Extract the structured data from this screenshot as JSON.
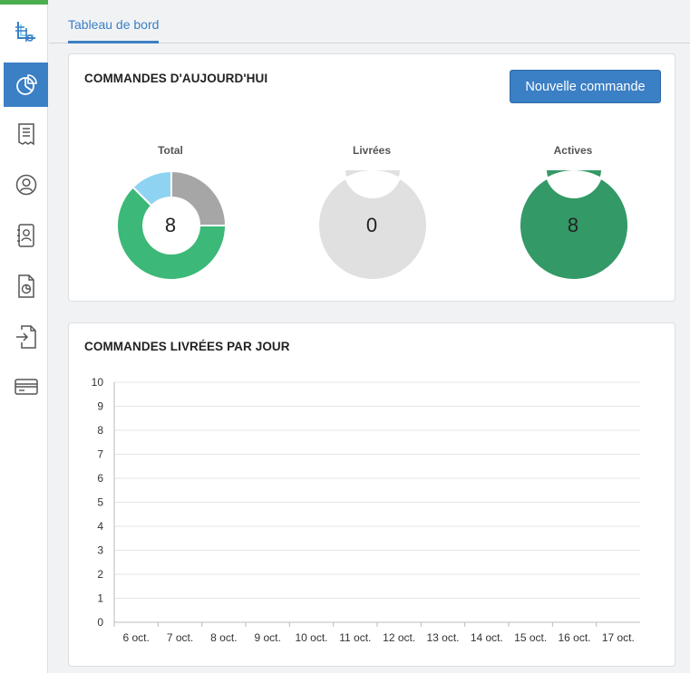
{
  "sidebar": {
    "items": [
      {
        "name": "logo",
        "icon": "app-logo-icon"
      },
      {
        "name": "dashboard",
        "icon": "pie-chart-icon",
        "active": true
      },
      {
        "name": "orders",
        "icon": "receipt-icon"
      },
      {
        "name": "users",
        "icon": "user-circle-icon"
      },
      {
        "name": "contacts",
        "icon": "contact-book-icon"
      },
      {
        "name": "reports",
        "icon": "document-chart-icon"
      },
      {
        "name": "import",
        "icon": "file-import-icon"
      },
      {
        "name": "billing",
        "icon": "credit-card-icon"
      }
    ],
    "accent": "#3b7fc4",
    "top_bar_color": "#4cae4c"
  },
  "tabs": [
    {
      "label": "Tableau de bord",
      "active": true
    }
  ],
  "today_card": {
    "title": "COMMANDES D'AUJOURD'HUI",
    "new_order_button": "Nouvelle commande",
    "donuts": [
      {
        "label": "Total",
        "value": "8",
        "segments": [
          {
            "fraction": 0.25,
            "color": "#a6a6a6"
          },
          {
            "fraction": 0.625,
            "color": "#3cb878"
          },
          {
            "fraction": 0.125,
            "color": "#8fd3f2"
          }
        ]
      },
      {
        "label": "Livrées",
        "value": "0",
        "segments": [
          {
            "fraction": 1.0,
            "color": "#e0e0e0"
          }
        ]
      },
      {
        "label": "Actives",
        "value": "8",
        "segments": [
          {
            "fraction": 1.0,
            "color": "#339966"
          }
        ]
      }
    ]
  },
  "delivered_card": {
    "title": "COMMANDES LIVRÉES PAR JOUR"
  },
  "chart_data": {
    "type": "bar",
    "title": "COMMANDES LIVRÉES PAR JOUR",
    "categories": [
      "6 oct.",
      "7 oct.",
      "8 oct.",
      "9 oct.",
      "10 oct.",
      "11 oct.",
      "12 oct.",
      "13 oct.",
      "14 oct.",
      "15 oct.",
      "16 oct.",
      "17 oct."
    ],
    "values": [
      0,
      0,
      0,
      0,
      0,
      0,
      0,
      0,
      0,
      0,
      0,
      0
    ],
    "yticks": [
      "0",
      "1",
      "2",
      "3",
      "4",
      "5",
      "6",
      "7",
      "8",
      "9",
      "10"
    ],
    "ylim": [
      0,
      10
    ],
    "grid": true
  }
}
